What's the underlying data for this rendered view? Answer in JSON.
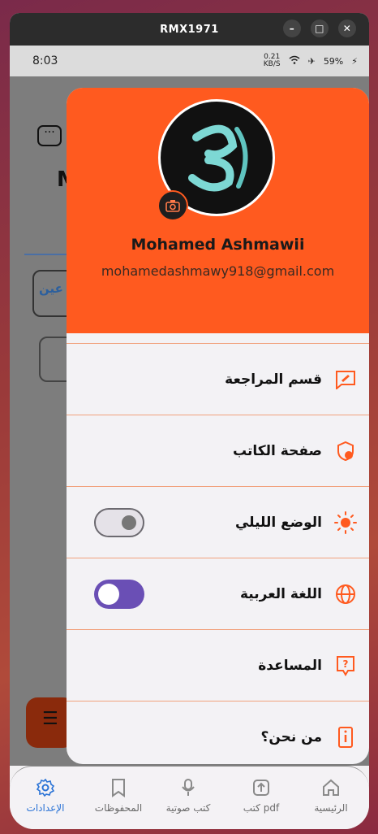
{
  "window": {
    "title": "RMX1971"
  },
  "status_bar": {
    "time": "8:03",
    "speed": "0.21",
    "speed_unit": "KB/S",
    "battery": "59%"
  },
  "background_app": {
    "title_partial": "M",
    "field_partial": "عين"
  },
  "drawer": {
    "user_name": "Mohamed Ashmawii",
    "user_email": "mohamedashmawy918@gmail.com",
    "accent_color": "#ff5a1f",
    "items": [
      {
        "label": "قسم المراجعة",
        "icon": "review-edit-icon"
      },
      {
        "label": "صفحة الكاتب",
        "icon": "writer-shield-icon"
      },
      {
        "label": "الوضع الليلي",
        "icon": "sun-icon",
        "toggle": false
      },
      {
        "label": "اللغة العربية",
        "icon": "globe-icon",
        "toggle": true
      },
      {
        "label": "المساعدة",
        "icon": "help-icon"
      },
      {
        "label": "من نحن؟",
        "icon": "info-icon"
      }
    ]
  },
  "bottom_nav": {
    "items": [
      {
        "label": "الإعدادات",
        "icon": "gear-icon",
        "active": true
      },
      {
        "label": "المحفوظات",
        "icon": "bookmark-icon",
        "active": false
      },
      {
        "label": "كتب صوتية",
        "icon": "microphone-icon",
        "active": false
      },
      {
        "label": "كتب pdf",
        "icon": "upload-icon",
        "active": false
      },
      {
        "label": "الرئيسية",
        "icon": "home-icon",
        "active": false
      }
    ],
    "active_color": "#2a73d6"
  }
}
